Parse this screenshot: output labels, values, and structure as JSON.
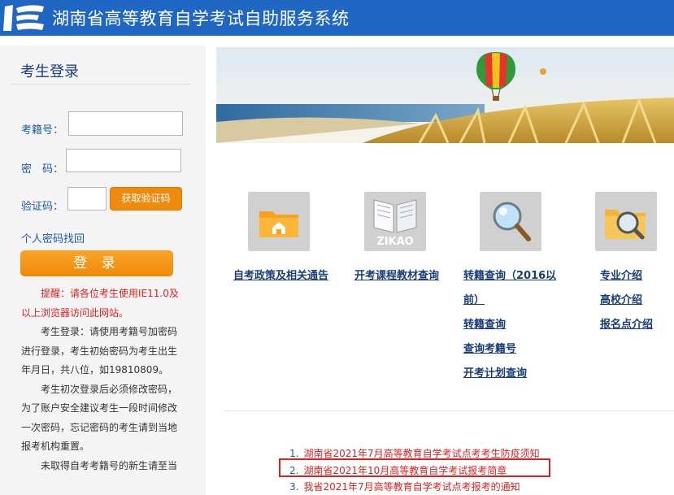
{
  "header": {
    "title": "湖南省高等教育自学考试自助服务系统",
    "bg_color": "#1f67c2"
  },
  "login": {
    "title": "考生登录",
    "exam_id_label": "考籍号：",
    "password_label": "密　码：",
    "captcha_label": "验证码：",
    "captcha_button": "获取验证码",
    "forgot_link": "个人密码找回",
    "login_button": "登 录",
    "notes": [
      "提醒：请各位考生使用IE11.0及以上浏览器访问此网站。",
      "考生登录：请使用考籍号加密码进行登录，考生初始密码为考生出生年月日，共八位，如19810809。",
      "考生初次登录后必须修改密码，为了账户安全建议考生一段时间修改一次密码，忘记密码的考生请到当地报考机构重置。",
      "未取得自考考籍号的新生请至当"
    ]
  },
  "nav": {
    "icons": [
      "folder-home-icon",
      "zikao-book-icon",
      "magnifier-icon",
      "folder-search-icon"
    ],
    "zikao_text": "ZIKAO",
    "col1": [
      "自考政策及相关通告"
    ],
    "col2": [
      "开考课程教材查询"
    ],
    "col3": [
      "转籍查询（2016以",
      "前）",
      "转籍查询",
      "查询考籍号",
      "开考计划查询"
    ],
    "col4": [
      "专业介绍",
      "高校介绍",
      "报名点介绍"
    ]
  },
  "notices": [
    {
      "num": "1.",
      "text": "湖南省2021年7月高等教育自学考试点考考生防疫须知"
    },
    {
      "num": "2.",
      "text": "湖南省2021年10月高等教育自学考试报考简章"
    },
    {
      "num": "3.",
      "text": "我省2021年7月高等教育自学考试点考报考的通知"
    }
  ],
  "colors": {
    "accent": "#f08a0c",
    "link": "#1a3d7a",
    "alert": "#e02020"
  }
}
